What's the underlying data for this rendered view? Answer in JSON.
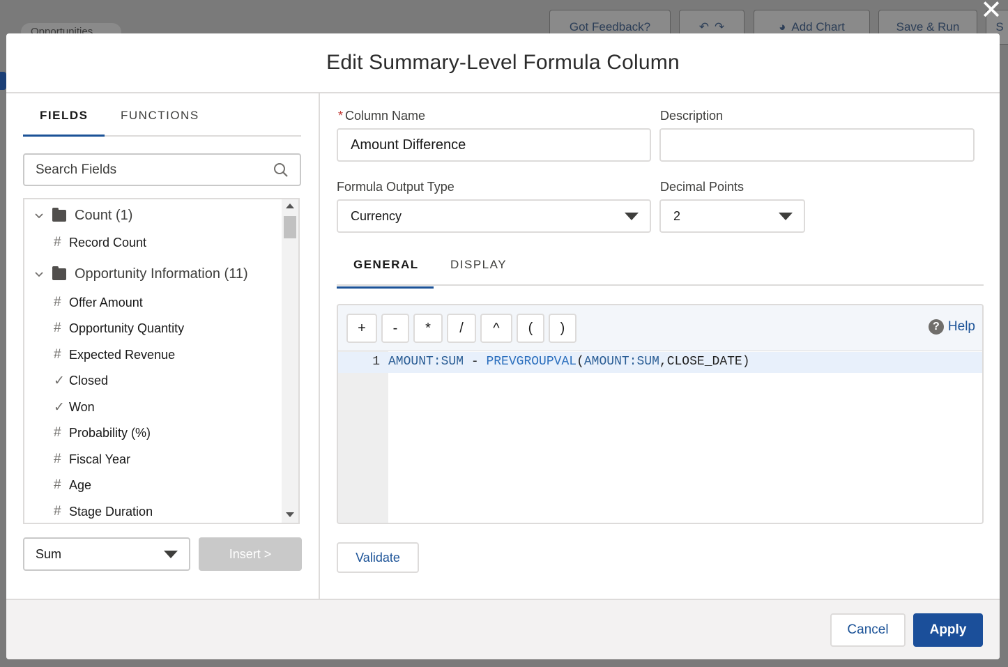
{
  "background": {
    "pill_text": "Opportunities",
    "buttons": {
      "feedback": "Got Feedback?",
      "add_chart": "Add Chart",
      "save_run": "Save & Run",
      "partial": "S"
    }
  },
  "modal": {
    "title": "Edit Summary-Level Formula Column"
  },
  "left": {
    "tabs": [
      "FIELDS",
      "FUNCTIONS"
    ],
    "active_tab": "FIELDS",
    "search_placeholder": "Search Fields",
    "groups": [
      {
        "label": "Count (1)",
        "fields": [
          {
            "icon": "#",
            "label": "Record Count"
          }
        ]
      },
      {
        "label": "Opportunity Information (11)",
        "fields": [
          {
            "icon": "#",
            "label": "Offer Amount"
          },
          {
            "icon": "#",
            "label": "Opportunity Quantity"
          },
          {
            "icon": "#",
            "label": "Expected Revenue"
          },
          {
            "icon": "✓",
            "label": "Closed"
          },
          {
            "icon": "✓",
            "label": "Won"
          },
          {
            "icon": "#",
            "label": "Probability (%)"
          },
          {
            "icon": "#",
            "label": "Fiscal Year"
          },
          {
            "icon": "#",
            "label": "Age"
          },
          {
            "icon": "#",
            "label": "Stage Duration"
          }
        ]
      }
    ],
    "aggregate_value": "Sum",
    "insert_label": "Insert >"
  },
  "right": {
    "column_name_label": "Column Name",
    "column_name_value": "Amount Difference",
    "description_label": "Description",
    "description_value": "",
    "output_type_label": "Formula Output Type",
    "output_type_value": "Currency",
    "decimal_label": "Decimal Points",
    "decimal_value": "2",
    "tabs": [
      "GENERAL",
      "DISPLAY"
    ],
    "active_tab": "GENERAL",
    "operators": [
      "+",
      "-",
      "*",
      "/",
      "^",
      "(",
      ")"
    ],
    "help_label": "Help",
    "line_number": "1",
    "formula": {
      "part1": "AMOUNT:SUM",
      "part2": " - ",
      "part3": "PREVGROUPVAL",
      "part4": "(",
      "part5": "AMOUNT:SUM",
      "part6": ",CLOSE_DATE)"
    },
    "validate_label": "Validate"
  },
  "footer": {
    "cancel_label": "Cancel",
    "apply_label": "Apply"
  },
  "colors": {
    "brand": "#1b4f9a",
    "link": "#1b5297",
    "required": "#c23934"
  }
}
